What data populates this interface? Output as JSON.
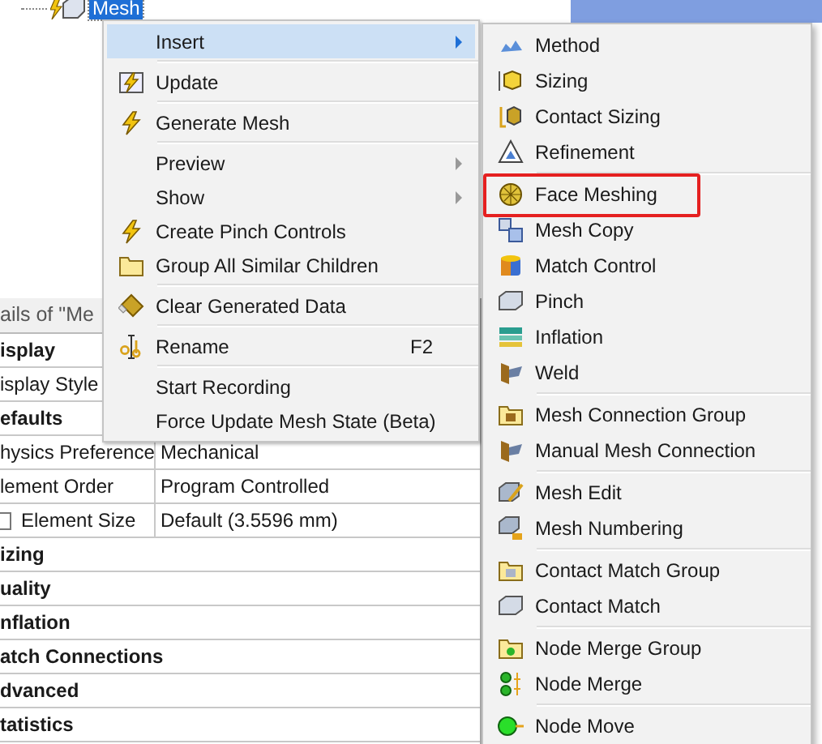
{
  "tree": {
    "label": "Mesh",
    "selected": true
  },
  "details": {
    "title": "ails of \"Me",
    "rows": [
      {
        "kind": "group",
        "label": "isplay"
      },
      {
        "kind": "property",
        "label": "isplay Style"
      },
      {
        "kind": "group",
        "label": "efaults"
      },
      {
        "kind": "property",
        "label": "hysics Preference",
        "value": "Mechanical"
      },
      {
        "kind": "property",
        "label": "lement Order",
        "value": "Program Controlled"
      },
      {
        "kind": "checkbox",
        "label": "Element Size",
        "value": "Default (3.5596 mm)",
        "checked": false
      },
      {
        "kind": "group",
        "label": "izing"
      },
      {
        "kind": "group",
        "label": "uality"
      },
      {
        "kind": "group",
        "label": "nflation"
      },
      {
        "kind": "group",
        "label": "atch Connections"
      },
      {
        "kind": "group",
        "label": "dvanced"
      },
      {
        "kind": "group",
        "label": "tatistics"
      }
    ]
  },
  "context_menu": {
    "groups": [
      [
        {
          "label": "Insert",
          "submenu": true,
          "selected": true
        }
      ],
      [
        {
          "label": "Update",
          "submenu": false,
          "selected": false
        }
      ],
      [
        {
          "label": "Generate Mesh",
          "submenu": false,
          "selected": false
        }
      ],
      [
        {
          "label": "Preview",
          "submenu": true,
          "selected": false
        },
        {
          "label": "Show",
          "submenu": true,
          "selected": false
        },
        {
          "label": "Create Pinch Controls",
          "submenu": false,
          "selected": false
        },
        {
          "label": "Group All Similar Children",
          "submenu": false,
          "selected": false
        }
      ],
      [
        {
          "label": "Clear Generated Data",
          "submenu": false,
          "selected": false
        }
      ],
      [
        {
          "label": "Rename",
          "shortcut": "F2",
          "submenu": false,
          "selected": false
        }
      ],
      [
        {
          "label": "Start Recording",
          "submenu": false,
          "selected": false
        },
        {
          "label": "Force Update Mesh State (Beta)",
          "submenu": false,
          "selected": false
        }
      ]
    ]
  },
  "insert_submenu": {
    "groups": [
      [
        {
          "label": "Method",
          "highlighted": false
        },
        {
          "label": "Sizing",
          "highlighted": false
        },
        {
          "label": "Contact Sizing",
          "highlighted": false
        },
        {
          "label": "Refinement",
          "highlighted": false
        }
      ],
      [
        {
          "label": "Face Meshing",
          "highlighted": true
        },
        {
          "label": "Mesh Copy",
          "highlighted": false
        },
        {
          "label": "Match Control",
          "highlighted": false
        },
        {
          "label": "Pinch",
          "highlighted": false
        },
        {
          "label": "Inflation",
          "highlighted": false
        },
        {
          "label": "Weld",
          "highlighted": false
        }
      ],
      [
        {
          "label": "Mesh Connection Group",
          "highlighted": false
        },
        {
          "label": "Manual Mesh Connection",
          "highlighted": false
        }
      ],
      [
        {
          "label": "Mesh Edit",
          "highlighted": false
        },
        {
          "label": "Mesh Numbering",
          "highlighted": false
        }
      ],
      [
        {
          "label": "Contact Match Group",
          "highlighted": false
        },
        {
          "label": "Contact Match",
          "highlighted": false
        }
      ],
      [
        {
          "label": "Node Merge Group",
          "highlighted": false
        },
        {
          "label": "Node Merge",
          "highlighted": false
        }
      ],
      [
        {
          "label": "Node Move",
          "highlighted": false
        }
      ]
    ]
  }
}
